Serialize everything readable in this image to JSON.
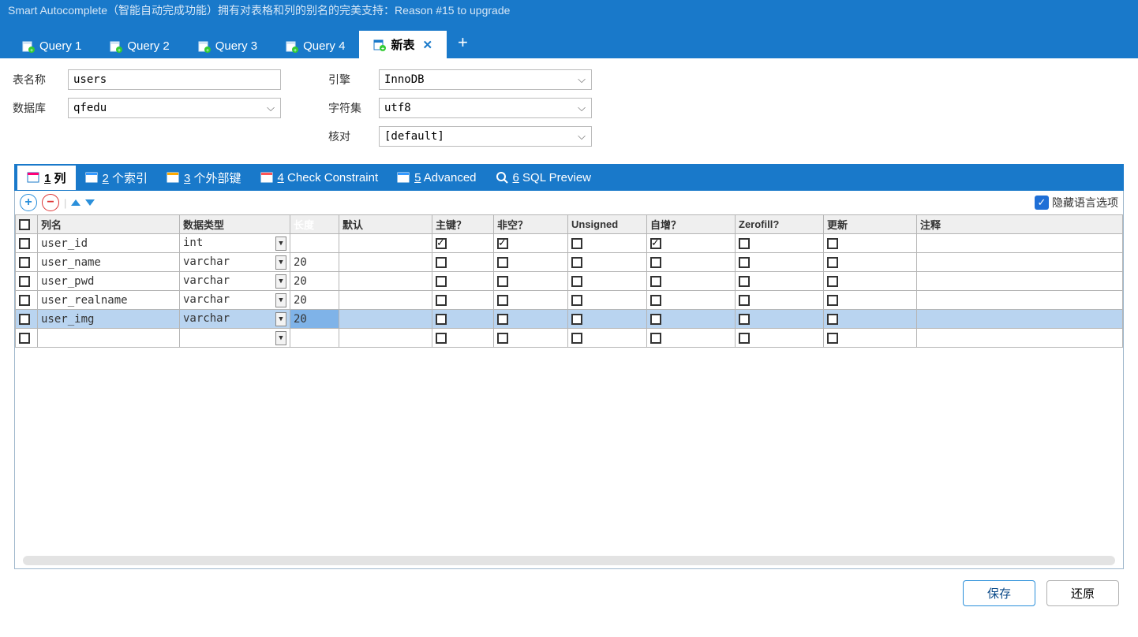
{
  "titlebar": "Smart Autocomplete（智能自动完成功能）拥有对表格和列的别名的完美支持：Reason #15 to upgrade",
  "tabs": [
    {
      "label": "Query 1"
    },
    {
      "label": "Query 2"
    },
    {
      "label": "Query 3"
    },
    {
      "label": "Query 4"
    },
    {
      "label": "新表",
      "active": true
    }
  ],
  "form": {
    "table_name_label": "表名称",
    "table_name": "users",
    "database_label": "数据库",
    "database": "qfedu",
    "engine_label": "引擎",
    "engine": "InnoDB",
    "charset_label": "字符集",
    "charset": "utf8",
    "collation_label": "核对",
    "collation": "[default]"
  },
  "subtabs": [
    {
      "num": "1",
      "label": "列",
      "active": true
    },
    {
      "num": "2",
      "label": "个索引"
    },
    {
      "num": "3",
      "label": "个外部键"
    },
    {
      "num": "4",
      "label": "Check Constraint"
    },
    {
      "num": "5",
      "label": "Advanced"
    },
    {
      "num": "6",
      "label": "SQL Preview"
    }
  ],
  "hide_lang_label": "隐藏语言选项",
  "columns_header": {
    "name": "列名",
    "datatype": "数据类型",
    "length": "长度",
    "default": "默认",
    "pk": "主键？",
    "nn": "非空？",
    "unsigned": "Unsigned",
    "ai": "自增？",
    "zf": "Zerofill?",
    "update": "更新",
    "comment": "注释"
  },
  "rows": [
    {
      "name": "user_id",
      "datatype": "int",
      "length": "",
      "pk": true,
      "nn": true,
      "unsigned": false,
      "ai": true,
      "zf": false,
      "upd": false
    },
    {
      "name": "user_name",
      "datatype": "varchar",
      "length": "20",
      "pk": false,
      "nn": false,
      "unsigned": false,
      "ai": false,
      "zf": false,
      "upd": false
    },
    {
      "name": "user_pwd",
      "datatype": "varchar",
      "length": "20",
      "pk": false,
      "nn": false,
      "unsigned": false,
      "ai": false,
      "zf": false,
      "upd": false
    },
    {
      "name": "user_realname",
      "datatype": "varchar",
      "length": "20",
      "pk": false,
      "nn": false,
      "unsigned": false,
      "ai": false,
      "zf": false,
      "upd": false
    },
    {
      "name": "user_img",
      "datatype": "varchar",
      "length": "20",
      "pk": false,
      "nn": false,
      "unsigned": false,
      "ai": false,
      "zf": false,
      "upd": false,
      "selected": true
    },
    {
      "name": "",
      "datatype": "",
      "length": "",
      "pk": false,
      "nn": false,
      "unsigned": false,
      "ai": false,
      "zf": false,
      "upd": false
    }
  ],
  "footer": {
    "save": "保存",
    "revert": "还原"
  }
}
